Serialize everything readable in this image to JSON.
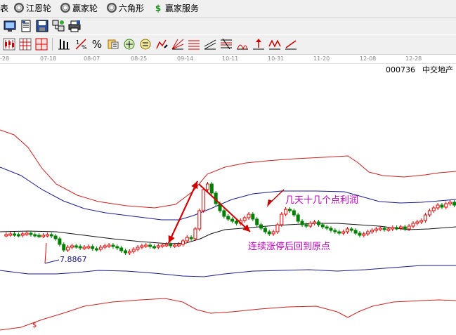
{
  "menu": {
    "items": [
      {
        "label": "表",
        "icon": "none"
      },
      {
        "label": "江恩轮",
        "icon": "target-icon"
      },
      {
        "label": "赢家轮",
        "icon": "target-icon"
      },
      {
        "label": "六角形",
        "icon": "target-icon"
      },
      {
        "label": "赢家服务",
        "icon": "dollar-icon"
      }
    ]
  },
  "toolbar": {
    "row1_icons": [
      "monitor-icon",
      "document-icon",
      "save-icon",
      "network-icon",
      "printer-icon"
    ],
    "row2_icons": [
      "kline-icon",
      "kline-grid-icon",
      "separator",
      "bars-icon",
      "ratio-icon",
      "percent-icon",
      "compare-icon",
      "overlay-icon",
      "equal-icon",
      "drawing-icon",
      "gann-icon",
      "fan-icon",
      "channel-icon",
      "fib-icon",
      "cycle-icon",
      "arrow-icon",
      "wave-icon"
    ],
    "percent_label": "%"
  },
  "dates": [
    "-28",
    "07-18",
    "08-07",
    "08-25",
    "09-14",
    "10-11",
    "10-31",
    "11-20",
    "12-08",
    "12-28"
  ],
  "stock": {
    "code": "000736",
    "name": "中交地产"
  },
  "annotations": {
    "low_price": "7.8867",
    "profit_note": "几天十几个点利润",
    "return_note": "连续涨停后回到原点",
    "dollar_marker": "$"
  },
  "colors": {
    "up": "#e00000",
    "down": "#008000",
    "upper_band": "#cc2222",
    "mid_band": "#1a1a8c",
    "ma_line": "#111111",
    "annotation": "#c000c0",
    "arrow": "#d00000"
  }
}
